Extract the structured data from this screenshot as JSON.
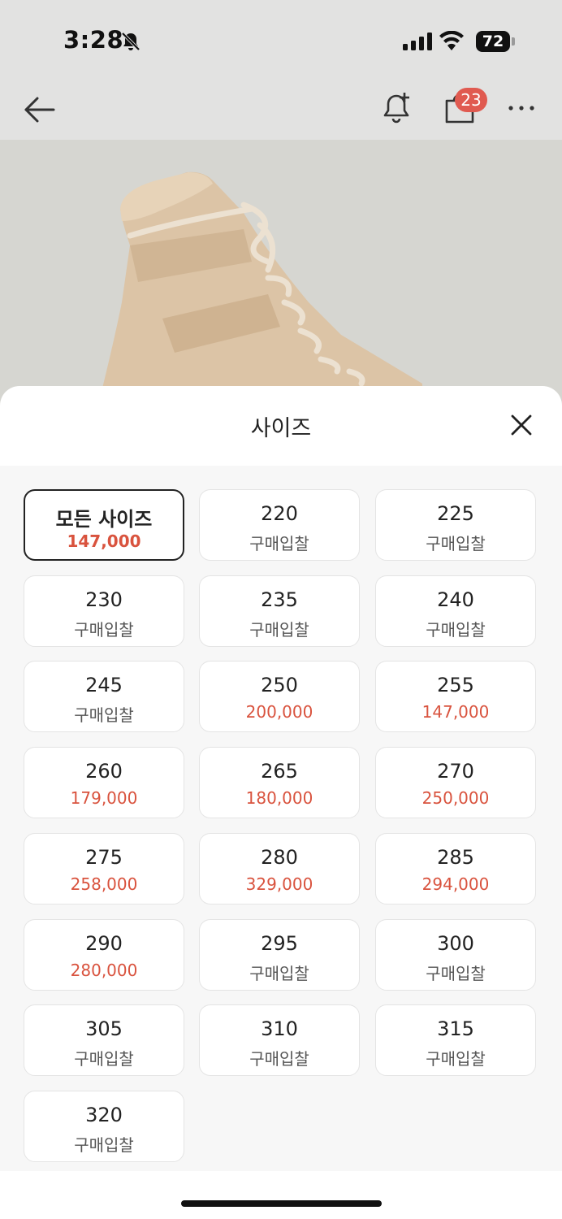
{
  "status_bar": {
    "time": "3:28",
    "battery": "72"
  },
  "nav": {
    "cart_badge": "23"
  },
  "sheet": {
    "title": "사이즈"
  },
  "sizes": [
    {
      "size": "모든 사이즈",
      "price": "147,000",
      "selected": true,
      "has_price": true
    },
    {
      "size": "220",
      "price": "구매입찰",
      "selected": false,
      "has_price": false
    },
    {
      "size": "225",
      "price": "구매입찰",
      "selected": false,
      "has_price": false
    },
    {
      "size": "230",
      "price": "구매입찰",
      "selected": false,
      "has_price": false
    },
    {
      "size": "235",
      "price": "구매입찰",
      "selected": false,
      "has_price": false
    },
    {
      "size": "240",
      "price": "구매입찰",
      "selected": false,
      "has_price": false
    },
    {
      "size": "245",
      "price": "구매입찰",
      "selected": false,
      "has_price": false
    },
    {
      "size": "250",
      "price": "200,000",
      "selected": false,
      "has_price": true
    },
    {
      "size": "255",
      "price": "147,000",
      "selected": false,
      "has_price": true
    },
    {
      "size": "260",
      "price": "179,000",
      "selected": false,
      "has_price": true
    },
    {
      "size": "265",
      "price": "180,000",
      "selected": false,
      "has_price": true
    },
    {
      "size": "270",
      "price": "250,000",
      "selected": false,
      "has_price": true
    },
    {
      "size": "275",
      "price": "258,000",
      "selected": false,
      "has_price": true
    },
    {
      "size": "280",
      "price": "329,000",
      "selected": false,
      "has_price": true
    },
    {
      "size": "285",
      "price": "294,000",
      "selected": false,
      "has_price": true
    },
    {
      "size": "290",
      "price": "280,000",
      "selected": false,
      "has_price": true
    },
    {
      "size": "295",
      "price": "구매입찰",
      "selected": false,
      "has_price": false
    },
    {
      "size": "300",
      "price": "구매입찰",
      "selected": false,
      "has_price": false
    },
    {
      "size": "305",
      "price": "구매입찰",
      "selected": false,
      "has_price": false
    },
    {
      "size": "310",
      "price": "구매입찰",
      "selected": false,
      "has_price": false
    },
    {
      "size": "315",
      "price": "구매입찰",
      "selected": false,
      "has_price": false
    },
    {
      "size": "320",
      "price": "구매입찰",
      "selected": false,
      "has_price": false
    }
  ],
  "colors": {
    "price_red": "#d9533e",
    "badge": "#e05a50",
    "sheet_bg": "#f7f7f7"
  },
  "icons": [
    "bell-slash-icon",
    "signal-icon",
    "wifi-icon",
    "battery-icon",
    "back-arrow-icon",
    "bell-add-icon",
    "shopping-bag-icon",
    "more-icon",
    "close-icon"
  ]
}
